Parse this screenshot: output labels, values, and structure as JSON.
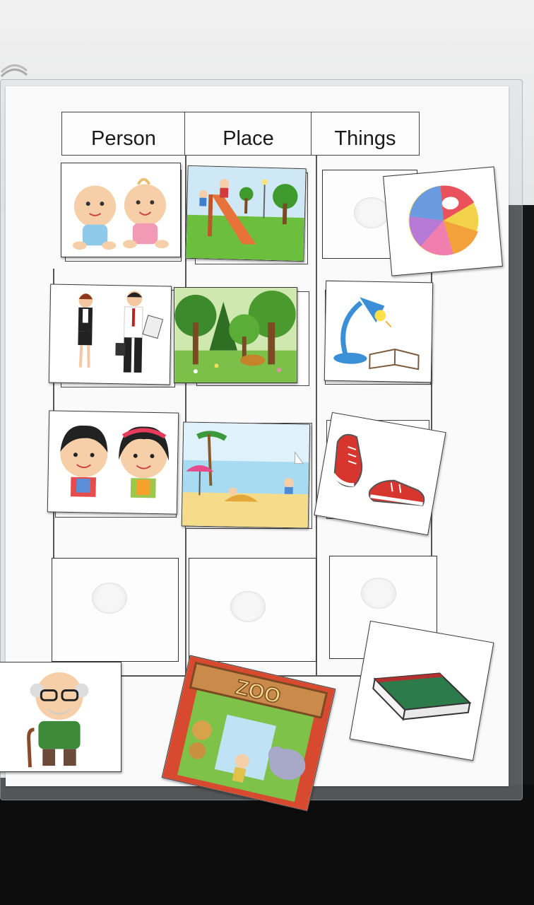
{
  "sorting_board": {
    "headers": [
      "Person",
      "Place",
      "Things"
    ]
  },
  "cards": [
    {
      "id": "babies",
      "category": "Person",
      "icon": "twin-babies-icon"
    },
    {
      "id": "playground",
      "category": "Place",
      "icon": "playground-slide-icon"
    },
    {
      "id": "ball",
      "category": "Things",
      "icon": "beach-ball-icon"
    },
    {
      "id": "workers",
      "category": "Person",
      "icon": "office-workers-icon"
    },
    {
      "id": "forest",
      "category": "Place",
      "icon": "forest-icon"
    },
    {
      "id": "lamp-book",
      "category": "Things",
      "icon": "desk-lamp-book-icon"
    },
    {
      "id": "kids",
      "category": "Person",
      "icon": "school-kids-icon"
    },
    {
      "id": "beach",
      "category": "Place",
      "icon": "beach-icon"
    },
    {
      "id": "sneakers",
      "category": "Things",
      "icon": "red-sneakers-icon"
    },
    {
      "id": "grandpa",
      "category": "Person",
      "icon": "grandpa-icon"
    },
    {
      "id": "zoo",
      "category": "Place",
      "icon": "zoo-gate-icon",
      "sign": "ZOO"
    },
    {
      "id": "green-book",
      "category": "Things",
      "icon": "green-book-icon"
    }
  ]
}
